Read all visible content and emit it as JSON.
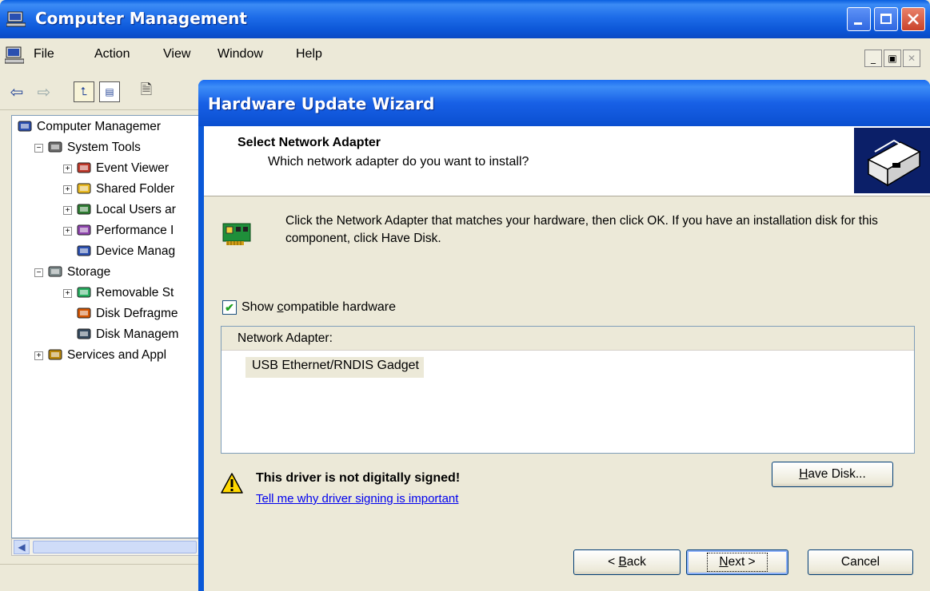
{
  "main_window": {
    "title": "Computer Management",
    "menu": [
      "File",
      "Action",
      "View",
      "Window",
      "Help"
    ],
    "tree": [
      {
        "label": "Computer Managemer",
        "icon": "computer-icon",
        "level": 0
      },
      {
        "label": "System Tools",
        "icon": "tools-icon",
        "level": 1,
        "expander": "−"
      },
      {
        "label": "Event Viewer",
        "icon": "event-viewer-icon",
        "level": 2,
        "expander": "+"
      },
      {
        "label": "Shared Folder",
        "icon": "shared-folder-icon",
        "level": 2,
        "expander": "+"
      },
      {
        "label": "Local Users ar",
        "icon": "users-icon",
        "level": 2,
        "expander": "+"
      },
      {
        "label": "Performance I",
        "icon": "performance-icon",
        "level": 2,
        "expander": "+"
      },
      {
        "label": "Device Manag",
        "icon": "device-manager-icon",
        "level": 2
      },
      {
        "label": "Storage",
        "icon": "storage-icon",
        "level": 1,
        "expander": "−"
      },
      {
        "label": "Removable St",
        "icon": "removable-storage-icon",
        "level": 2,
        "expander": "+"
      },
      {
        "label": "Disk Defragme",
        "icon": "defrag-icon",
        "level": 2
      },
      {
        "label": "Disk Managem",
        "icon": "disk-management-icon",
        "level": 2
      },
      {
        "label": "Services and Appl",
        "icon": "services-icon",
        "level": 1,
        "expander": "+"
      }
    ]
  },
  "wizard": {
    "title": "Hardware Update Wizard",
    "header_title": "Select Network Adapter",
    "header_subtitle": "Which network adapter do you want to install?",
    "info_text": "Click the Network Adapter that matches your hardware, then click OK. If you have an installation disk for this component, click Have Disk.",
    "checkbox": {
      "pre": "Show ",
      "accel": "c",
      "post": "ompatible hardware",
      "checked": true
    },
    "list_header": "Network Adapter:",
    "list_items": [
      "USB Ethernet/RNDIS Gadget"
    ],
    "warning_text": "This driver is not digitally signed!",
    "warning_link": "Tell me why driver signing is important",
    "have_disk": {
      "accel": "H",
      "rest": "ave Disk..."
    },
    "back": {
      "pre": "< ",
      "accel": "B",
      "rest": "ack"
    },
    "next": {
      "accel": "N",
      "rest": "ext >"
    },
    "cancel": "Cancel"
  },
  "colors": {
    "xp_blue": "#0a58d8",
    "dialog_face": "#ece9d8",
    "link": "#0000ee"
  }
}
